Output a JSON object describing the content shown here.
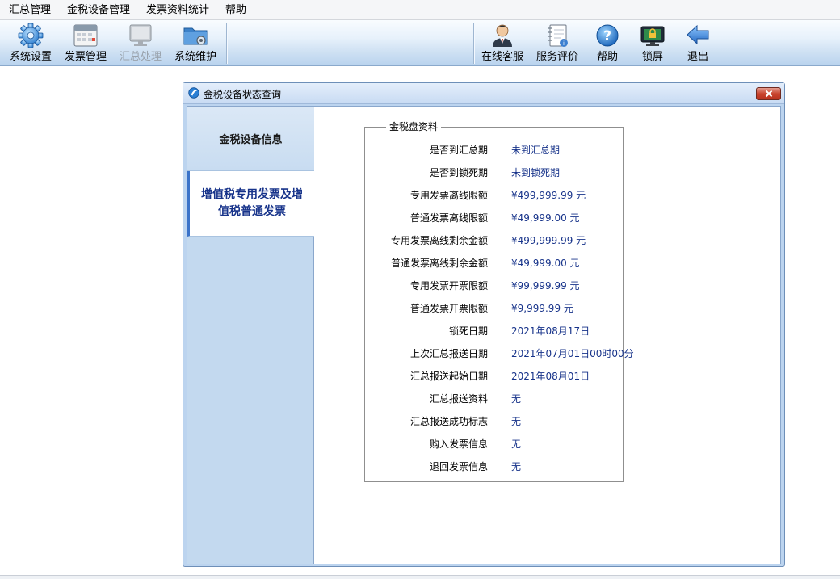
{
  "menubar": {
    "items": [
      "汇总管理",
      "金税设备管理",
      "发票资料统计",
      "帮助"
    ]
  },
  "toolbar": {
    "left": [
      {
        "label": "系统设置",
        "icon": "gear-icon",
        "enabled": true
      },
      {
        "label": "发票管理",
        "icon": "calendar-grid-icon",
        "enabled": true
      },
      {
        "label": "汇总处理",
        "icon": "monitor-icon",
        "enabled": false
      },
      {
        "label": "系统维护",
        "icon": "folder-gear-icon",
        "enabled": true
      }
    ],
    "right": [
      {
        "label": "在线客服",
        "icon": "agent-icon"
      },
      {
        "label": "服务评价",
        "icon": "notebook-icon"
      },
      {
        "label": "帮助",
        "icon": "question-icon"
      },
      {
        "label": "锁屏",
        "icon": "lock-screen-icon"
      },
      {
        "label": "退出",
        "icon": "back-arrow-icon"
      }
    ]
  },
  "dialog": {
    "title": "金税设备状态查询",
    "nav": [
      {
        "label": "金税设备信息",
        "active": false
      },
      {
        "label": "增值税专用发票及增值税普通发票",
        "active": true
      }
    ],
    "group_title": "金税盘资料",
    "rows": [
      {
        "key": "是否到汇总期",
        "value": "未到汇总期"
      },
      {
        "key": "是否到锁死期",
        "value": "未到锁死期"
      },
      {
        "key": "专用发票离线限额",
        "value": "¥499,999.99 元"
      },
      {
        "key": "普通发票离线限额",
        "value": "¥49,999.00 元"
      },
      {
        "key": "专用发票离线剩余金额",
        "value": "¥499,999.99 元"
      },
      {
        "key": "普通发票离线剩余金额",
        "value": "¥49,999.00 元"
      },
      {
        "key": "专用发票开票限额",
        "value": "¥99,999.99 元"
      },
      {
        "key": "普通发票开票限额",
        "value": "¥9,999.99 元"
      },
      {
        "key": "锁死日期",
        "value": "2021年08月17日"
      },
      {
        "key": "上次汇总报送日期",
        "value": "2021年07月01日00时00分"
      },
      {
        "key": "汇总报送起始日期",
        "value": "2021年08月01日"
      },
      {
        "key": "汇总报送资料",
        "value": "无"
      },
      {
        "key": "汇总报送成功标志",
        "value": "无"
      },
      {
        "key": "购入发票信息",
        "value": "无"
      },
      {
        "key": "退回发票信息",
        "value": "无"
      }
    ]
  },
  "colors": {
    "accent_blue": "#17338a",
    "nav_bg": "#c3d9ef",
    "close_red": "#c9452f"
  }
}
